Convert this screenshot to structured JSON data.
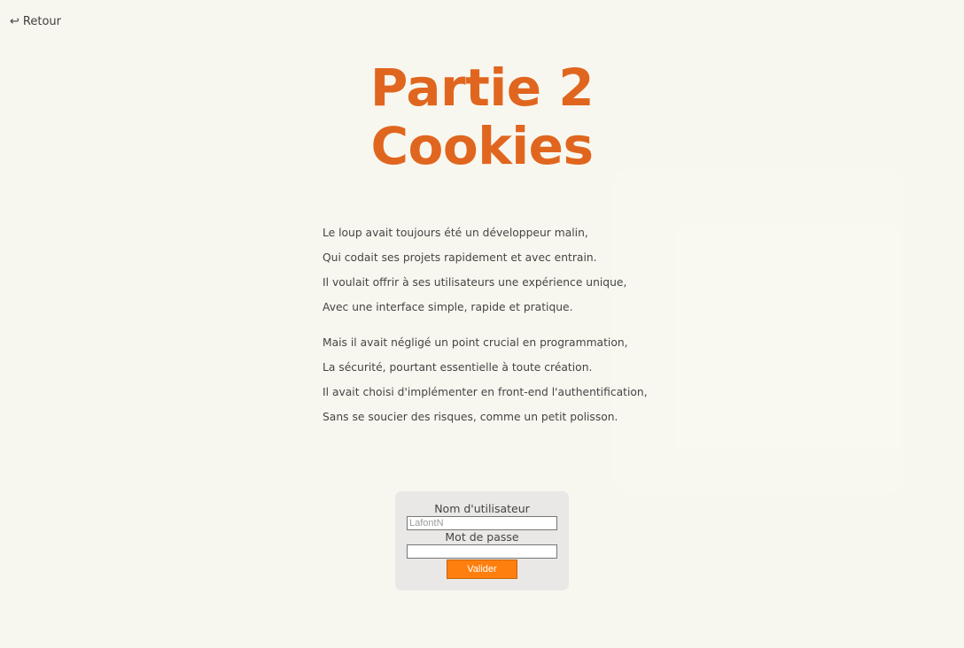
{
  "nav": {
    "back_icon": "return-arrow-icon",
    "back_icon_glyph": "↩",
    "back_label": "Retour"
  },
  "header": {
    "title_line1": "Partie 2",
    "title_line2": "Cookies"
  },
  "poem": {
    "stanza1": [
      "Le loup avait toujours été un développeur malin,",
      "Qui codait ses projets rapidement et avec entrain.",
      "Il voulait offrir à ses utilisateurs une expérience unique,",
      "Avec une interface simple, rapide et pratique."
    ],
    "stanza2": [
      "Mais il avait négligé un point crucial en programmation,",
      "La sécurité, pourtant essentielle à toute création.",
      "Il avait choisi d'implémenter en front-end l'authentification,",
      "Sans se soucier des risques, comme un petit polisson."
    ]
  },
  "login": {
    "username_label": "Nom d'utilisateur",
    "username_placeholder": "LafontN",
    "username_value": "",
    "password_label": "Mot de passe",
    "password_value": "",
    "submit_label": "Valider"
  },
  "colors": {
    "background": "#f8f7ef",
    "title": "#e0661f",
    "button": "#ff7f0e",
    "login_box": "#e9e8e6"
  }
}
